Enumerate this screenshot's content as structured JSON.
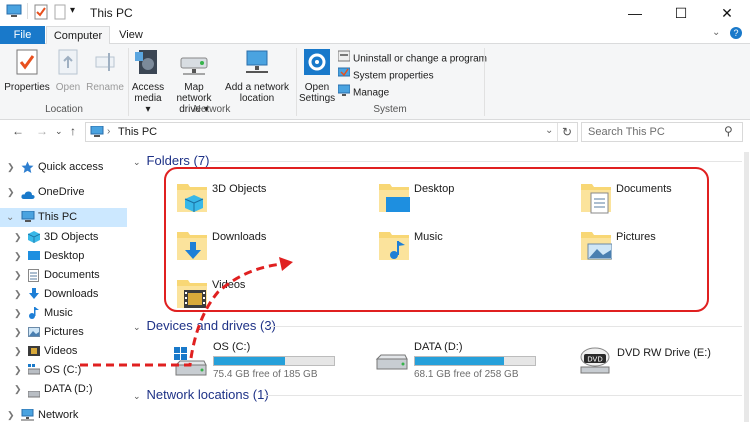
{
  "window": {
    "title": "This PC",
    "minimize_glyph": "—",
    "maximize_glyph": "☐",
    "close_glyph": "✕",
    "qat_dropdown_glyph": "▾"
  },
  "ribbon": {
    "tabs": [
      "File",
      "Computer",
      "View"
    ],
    "help_glyph": "?",
    "collapse_glyph": "⌄",
    "location": {
      "label": "Location",
      "properties": "Properties",
      "open": "Open",
      "rename": "Rename"
    },
    "network": {
      "label": "Network",
      "access_media": "Access media ▾",
      "map_network_drive": "Map network drive ▾",
      "add_network_location": "Add a network location"
    },
    "system": {
      "label": "System",
      "open_settings": "Open Settings",
      "uninstall": "Uninstall or change a program",
      "system_properties": "System properties",
      "manage": "Manage"
    }
  },
  "address_bar": {
    "back": "←",
    "forward": "→",
    "recent": "⌄",
    "up": "↑",
    "path": "This PC",
    "separator": "›",
    "dropdown": "⌄",
    "refresh": "↻",
    "search_placeholder": "Search This PC",
    "search_glyph": "⚲"
  },
  "nav_pane": {
    "items": [
      {
        "label": "Quick access"
      },
      {
        "label": "OneDrive"
      },
      {
        "label": "This PC"
      },
      {
        "label": "3D Objects"
      },
      {
        "label": "Desktop"
      },
      {
        "label": "Documents"
      },
      {
        "label": "Downloads"
      },
      {
        "label": "Music"
      },
      {
        "label": "Pictures"
      },
      {
        "label": "Videos"
      },
      {
        "label": "OS (C:)"
      },
      {
        "label": "DATA (D:)"
      },
      {
        "label": "Network"
      }
    ]
  },
  "content": {
    "folders_header": "Folders (7)",
    "folders": [
      "3D Objects",
      "Desktop",
      "Documents",
      "Downloads",
      "Music",
      "Pictures",
      "Videos"
    ],
    "drives_header": "Devices and drives (3)",
    "drives": [
      {
        "name": "OS (C:)",
        "free_text": "75.4 GB free of 185 GB",
        "used_fraction": 0.59
      },
      {
        "name": "DATA (D:)",
        "free_text": "68.1 GB free of 258 GB",
        "used_fraction": 0.74
      },
      {
        "name": "DVD RW Drive (E:)"
      }
    ],
    "network_header": "Network locations (1)"
  },
  "colors": {
    "accent": "#1979ca",
    "selection": "#cce8ff",
    "drive_bar": "#26a0da",
    "annotation_red": "#e02020",
    "folder_yellow": "#f8d775"
  }
}
